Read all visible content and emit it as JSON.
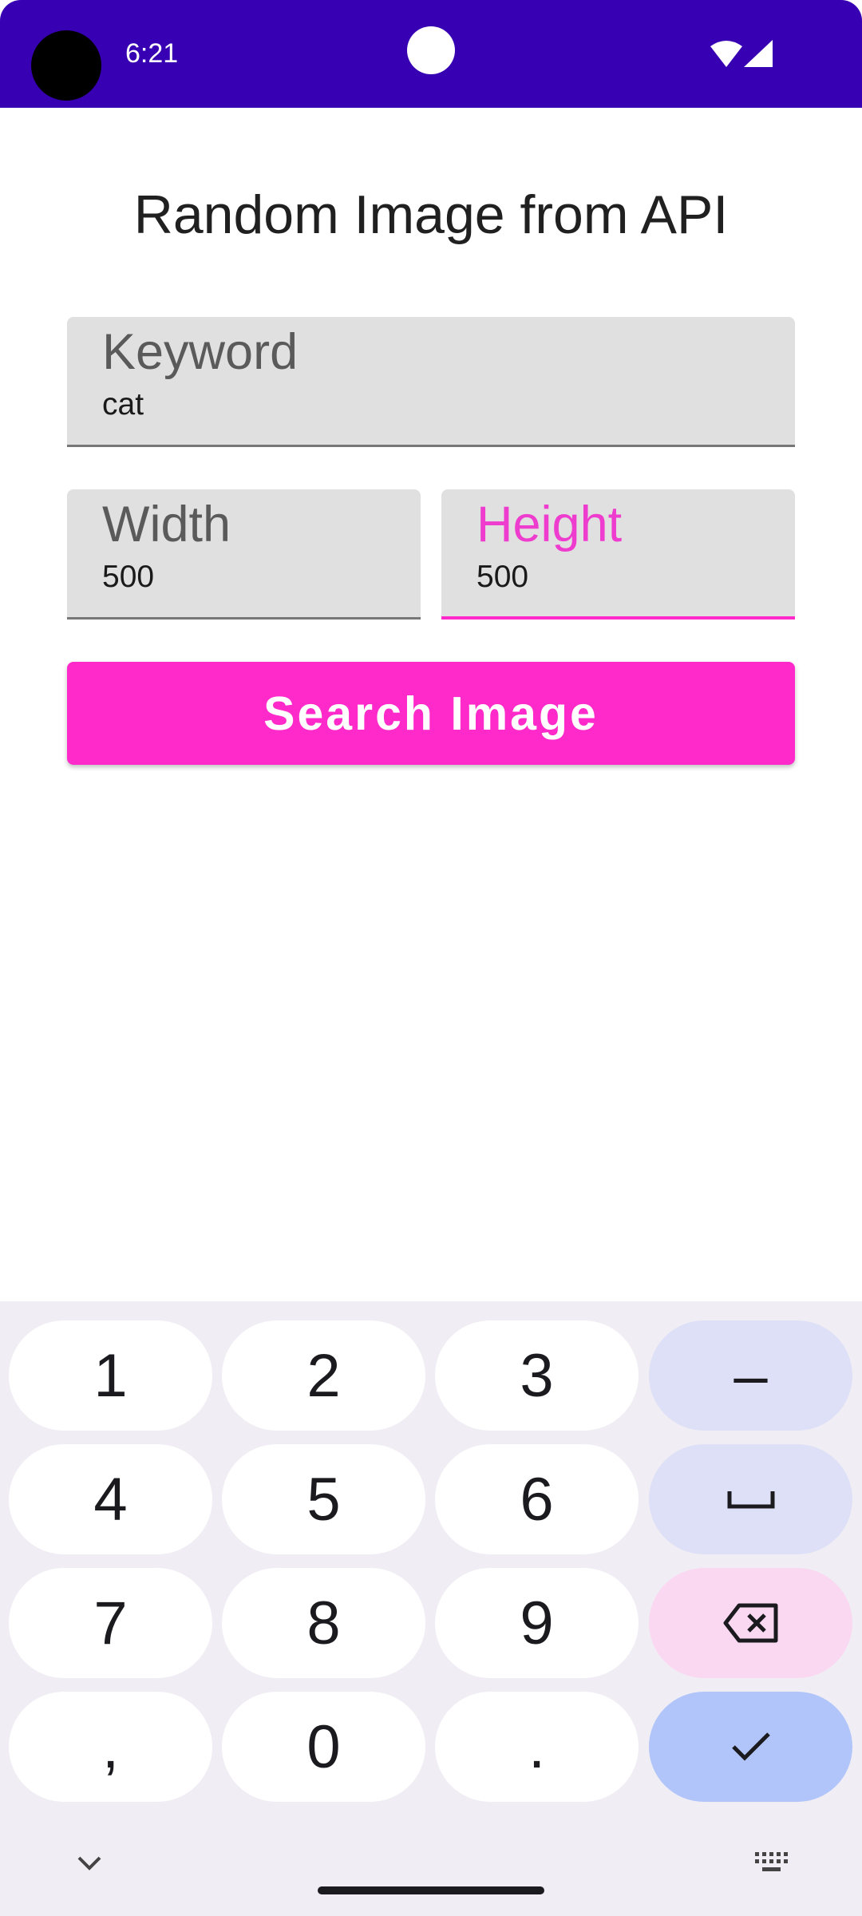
{
  "status_bar": {
    "time": "6:21",
    "background": "#3700b3"
  },
  "page": {
    "title": "Random Image from API"
  },
  "form": {
    "keyword": {
      "label": "Keyword",
      "value": "cat"
    },
    "width": {
      "label": "Width",
      "value": "500"
    },
    "height": {
      "label": "Height",
      "value": "500",
      "focused": true
    },
    "search_button_label": "Search Image",
    "accent_color": "#ff2ac9"
  },
  "keyboard": {
    "keys": [
      "1",
      "2",
      "3",
      "–",
      "4",
      "5",
      "6",
      "space",
      "7",
      "8",
      "9",
      "backspace",
      ",",
      "0",
      ".",
      "enter"
    ],
    "labels": {
      "k1": "1",
      "k2": "2",
      "k3": "3",
      "dash": "–",
      "k4": "4",
      "k5": "5",
      "k6": "6",
      "k7": "7",
      "k8": "8",
      "k9": "9",
      "comma": ",",
      "k0": "0",
      "period": "."
    },
    "icons": [
      "space-icon",
      "backspace-icon",
      "check-icon",
      "chevron-down-icon",
      "keyboard-icon"
    ]
  }
}
